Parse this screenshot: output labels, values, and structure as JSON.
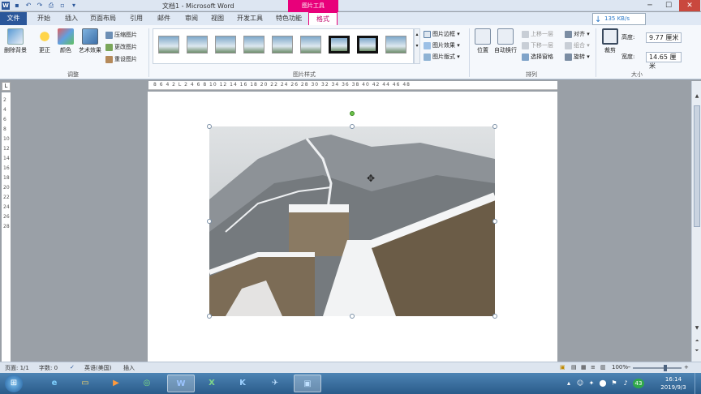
{
  "window": {
    "title": "文档1 - Microsoft Word",
    "context_tab_group": "图片工具",
    "min": "─",
    "max": "☐",
    "close": "✕"
  },
  "tabs": {
    "file": "文件",
    "items": [
      "开始",
      "插入",
      "页面布局",
      "引用",
      "邮件",
      "审阅",
      "视图",
      "开发工具",
      "特色功能"
    ],
    "format": "格式"
  },
  "network": {
    "speed": "135 KB/s"
  },
  "ribbon": {
    "adjust": {
      "label": "调整",
      "remove_bg": "删除背景",
      "corrections": "更正",
      "color": "颜色",
      "artistic": "艺术效果",
      "compress": "压缩图片",
      "change": "更改图片",
      "reset": "重设图片"
    },
    "styles": {
      "label": "图片样式",
      "border": "图片边框",
      "effects": "图片效果",
      "layout": "图片版式"
    },
    "arrange": {
      "label": "排列",
      "position": "位置",
      "wrap": "自动换行",
      "forward": "上移一层",
      "backward": "下移一层",
      "selection_pane": "选择窗格",
      "align": "对齐",
      "group": "组合",
      "rotate": "旋转"
    },
    "size": {
      "label": "大小",
      "crop": "裁剪",
      "height_label": "高度:",
      "height_value": "9.77 厘米",
      "width_label": "宽度:",
      "width_value": "14.65 厘米"
    }
  },
  "rulers": {
    "horizontal": "8 6 4 2 L 2 4 6 8 10 12 14 16 18 20 22 24 26 28 30 32 34 36 38 40 42 44 46 48",
    "vertical": "2 4 6 8 10 12 14 16 18 20 22 24 26 28",
    "corner": "L"
  },
  "status": {
    "page": "页面: 1/1",
    "words": "字数: 0",
    "language": "英语(美国)",
    "mode": "插入",
    "zoom": "100%",
    "zoom_minus": "−",
    "zoom_plus": "+"
  },
  "taskbar": {
    "time": "16:14",
    "date": "2019/9/3",
    "tray_badge": "43"
  },
  "colors": {
    "accent": "#2b579a",
    "context": "#e8007a"
  }
}
